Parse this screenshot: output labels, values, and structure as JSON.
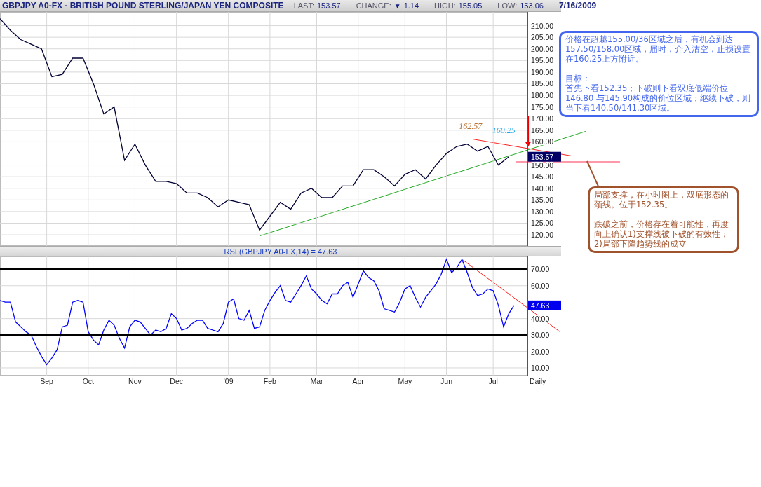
{
  "quote_bar": {
    "title": "GBPJPY A0-FX - BRITISH POUND STERLING/JAPAN YEN COMPOSITE",
    "fields": [
      {
        "label": "LAST:",
        "value": "153.57"
      },
      {
        "label": "CHANGE:",
        "indicator": "▼",
        "value": "1.14"
      },
      {
        "label": "HIGH:",
        "value": "155.05"
      },
      {
        "label": "LOW:",
        "value": "153.06"
      }
    ],
    "date": "7/16/2009"
  },
  "price_chart": {
    "chart_data": {
      "type": "line",
      "categories": [
        null,
        null,
        null,
        null,
        null,
        null,
        null,
        null,
        null,
        null,
        null,
        null,
        null,
        null,
        null,
        null,
        null,
        null,
        null,
        null,
        null,
        null,
        null,
        null,
        null,
        null,
        null,
        null,
        null,
        null,
        null,
        null,
        null,
        null,
        null,
        null,
        null,
        null,
        null,
        null,
        null,
        null,
        null,
        null,
        null,
        null,
        null,
        null,
        null,
        null
      ],
      "series": [
        {
          "color": "#000033",
          "values": [
            213,
            208,
            204,
            202,
            200,
            188,
            189,
            196,
            196,
            185,
            172,
            175,
            152,
            159,
            150,
            143,
            143,
            142,
            138,
            138,
            136,
            132,
            135,
            134,
            133,
            122,
            128,
            134,
            131,
            138,
            140,
            136,
            136,
            141,
            141,
            148,
            148,
            145,
            141,
            146,
            148,
            144,
            150,
            155,
            158,
            159,
            156,
            158,
            150,
            153.57
          ]
        }
      ],
      "ylim": [
        115.2,
        215.9
      ],
      "grid": true,
      "yticks": [
        {
          "value": 120,
          "label": "120.00"
        },
        {
          "value": 125,
          "label": "125.00"
        },
        {
          "value": 130,
          "label": "130.00"
        },
        {
          "value": 135,
          "label": "135.00"
        },
        {
          "value": 140,
          "label": "140.00"
        },
        {
          "value": 145,
          "label": "145.00"
        },
        {
          "value": 150,
          "label": "150.00"
        },
        {
          "value": 160,
          "label": "160.00"
        },
        {
          "value": 165,
          "label": "165.00"
        },
        {
          "value": 170,
          "label": "170.00"
        },
        {
          "value": 175,
          "label": "175.00"
        },
        {
          "value": 180,
          "label": "180.00"
        },
        {
          "value": 185,
          "label": "185.00"
        },
        {
          "value": 190,
          "label": "190.00"
        },
        {
          "value": 195,
          "label": "195.00"
        },
        {
          "value": 200,
          "label": "200.00"
        },
        {
          "value": 205,
          "label": "205.00"
        },
        {
          "value": 210,
          "label": "210.00"
        }
      ]
    },
    "drawings": [
      {
        "kind": "trend_line",
        "color": "#22aa22"
      },
      {
        "kind": "trend_line",
        "color": "#ff2020"
      },
      {
        "kind": "level_line",
        "color": "#ff99aa"
      },
      {
        "kind": "arrow",
        "color": "#ee0000"
      },
      {
        "kind": "label",
        "text": "162.57",
        "color": "#b87333"
      },
      {
        "kind": "label",
        "text": "160.25",
        "color": "#22aaee"
      }
    ],
    "last_value": "153.57"
  },
  "rsi_chart": {
    "title": "RSI (GBPJPY A0-FX,14) = 47.63",
    "periodicity": "Daily",
    "chart_data": {
      "type": "line",
      "categories": [
        null,
        null,
        null,
        null,
        null,
        null,
        null,
        null,
        null,
        "Sep",
        null,
        null,
        null,
        null,
        null,
        null,
        null,
        "Oct",
        null,
        null,
        null,
        null,
        null,
        null,
        null,
        null,
        "Nov",
        null,
        null,
        null,
        null,
        null,
        null,
        null,
        "Dec",
        null,
        null,
        null,
        null,
        null,
        null,
        null,
        null,
        null,
        "'09",
        null,
        null,
        null,
        null,
        null,
        null,
        null,
        "Feb",
        null,
        null,
        null,
        null,
        null,
        null,
        null,
        null,
        "Mar",
        null,
        null,
        null,
        null,
        null,
        null,
        null,
        "Apr",
        null,
        null,
        null,
        null,
        null,
        null,
        null,
        null,
        "May",
        null,
        null,
        null,
        null,
        null,
        null,
        null,
        "Jun",
        null,
        null,
        null,
        null,
        null,
        null,
        null,
        null,
        "Jul",
        null,
        null,
        null,
        null
      ],
      "series": [
        {
          "color": "#0000ff",
          "values": [
            51,
            50,
            50,
            38,
            35,
            32,
            30,
            23,
            17,
            12,
            16,
            21,
            35,
            36,
            50,
            51,
            50,
            32,
            27,
            24,
            33,
            39,
            36,
            28,
            22,
            35,
            39,
            38,
            34,
            30,
            33,
            32,
            34,
            43,
            40,
            33,
            34,
            37,
            39,
            39,
            34,
            33,
            32,
            37,
            50,
            52,
            40,
            39,
            45,
            34,
            35,
            45,
            51,
            56,
            60,
            51,
            50,
            55,
            60,
            66,
            58,
            55,
            51,
            49,
            55,
            55,
            60,
            62,
            53,
            61,
            69,
            65,
            63,
            57,
            46,
            45,
            44,
            50,
            58,
            60,
            53,
            47,
            53,
            57,
            61,
            67,
            76,
            68,
            71,
            76,
            68,
            59,
            54,
            55,
            58,
            57,
            48,
            35,
            43,
            48
          ]
        }
      ],
      "ylim": [
        5.3,
        77.8
      ],
      "grid": true,
      "yticks": [
        {
          "value": 10,
          "label": "10.00"
        },
        {
          "value": 20,
          "label": "20.00"
        },
        {
          "value": 30,
          "label": "30.00"
        },
        {
          "value": 40,
          "label": "40.00"
        },
        {
          "value": 60,
          "label": "60.00"
        },
        {
          "value": 70,
          "label": "70.00"
        }
      ]
    },
    "drawings": [
      {
        "kind": "level_line",
        "color": "#000000"
      },
      {
        "kind": "level_line",
        "color": "#000000"
      },
      {
        "kind": "trend_line",
        "color": "#ff2020"
      }
    ],
    "last_value": "47.63"
  },
  "notes": [
    {
      "color": "#4466ee",
      "paragraphs": [
        "价格在超越155.00/36区域之后，有机会到达157.50/158.00区域，届时，介入沽空，止损设置在160.25上方附近。",
        "目标：",
        "首先下看152.35；下破则下看双底低端价位146.80 与145.90构成的价位区域；继续下破，则当下看140.50/141.30区域。"
      ]
    },
    {
      "color": "#a0522d",
      "paragraphs": [
        "局部支撑，在小时图上，双底形态的颈线。位于152.35。",
        "跌破之前，价格存在着可能性，再度向上确认1)支撑线被下破的有效性；2)局部下降趋势线的成立"
      ]
    }
  ]
}
